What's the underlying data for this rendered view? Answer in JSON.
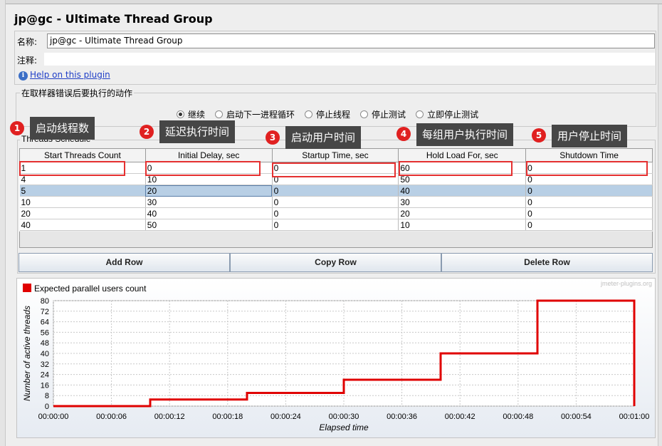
{
  "panel": {
    "title": "jp@gc - Ultimate Thread Group",
    "name_label": "名称:",
    "name_value": "jp@gc - Ultimate Thread Group",
    "comment_label": "注释:",
    "comment_value": "",
    "help_link": "Help on this plugin"
  },
  "sampler_error": {
    "legend": "在取样器错误后要执行的动作",
    "options": [
      "继续",
      "启动下一进程循环",
      "停止线程",
      "停止测试",
      "立即停止测试"
    ],
    "selected": "继续"
  },
  "schedule": {
    "legend": "Threads Schedule",
    "columns": [
      "Start Threads Count",
      "Initial Delay, sec",
      "Startup Time, sec",
      "Hold Load For, sec",
      "Shutdown Time"
    ],
    "rows": [
      [
        "1",
        "0",
        "0",
        "60",
        "0"
      ],
      [
        "4",
        "10",
        "0",
        "50",
        "0"
      ],
      [
        "5",
        "20",
        "0",
        "40",
        "0"
      ],
      [
        "10",
        "30",
        "0",
        "30",
        "0"
      ],
      [
        "20",
        "40",
        "0",
        "20",
        "0"
      ],
      [
        "40",
        "50",
        "0",
        "10",
        "0"
      ]
    ],
    "selected_row": 2,
    "buttons": {
      "add": "Add Row",
      "copy": "Copy Row",
      "delete": "Delete Row"
    }
  },
  "annotations": [
    {
      "number": "1",
      "text": "启动线程数"
    },
    {
      "number": "2",
      "text": "延迟执行时间"
    },
    {
      "number": "3",
      "text": "启动用户时间"
    },
    {
      "number": "4",
      "text": "每组用户执行时间"
    },
    {
      "number": "5",
      "text": "用户停止时间"
    }
  ],
  "chart_data": {
    "type": "line",
    "title": "",
    "watermark": "jmeter-plugins.org",
    "legend_position": "top-left",
    "grid": true,
    "xlabel": "Elapsed time",
    "ylabel": "Number of active threads",
    "xlim": [
      "00:00:00",
      "00:01:00"
    ],
    "ylim": [
      0,
      80
    ],
    "x_ticks": [
      "00:00:00",
      "00:00:06",
      "00:00:12",
      "00:00:18",
      "00:00:24",
      "00:00:30",
      "00:00:36",
      "00:00:42",
      "00:00:48",
      "00:00:54",
      "00:01:00"
    ],
    "y_ticks": [
      0,
      8,
      16,
      24,
      32,
      40,
      48,
      56,
      64,
      72,
      80
    ],
    "series": [
      {
        "name": "Expected parallel users count",
        "color": "#e00000",
        "x": [
          "00:00:00",
          "00:00:10",
          "00:00:10",
          "00:00:20",
          "00:00:20",
          "00:00:30",
          "00:00:30",
          "00:00:40",
          "00:00:40",
          "00:00:50",
          "00:00:50",
          "00:01:00",
          "00:01:00"
        ],
        "y": [
          0,
          0,
          5,
          5,
          10,
          10,
          20,
          20,
          40,
          40,
          80,
          80,
          0
        ]
      }
    ]
  },
  "colors": {
    "accent_red": "#e53030",
    "selection": "#b8cfe5",
    "callout_bg": "#464646"
  }
}
